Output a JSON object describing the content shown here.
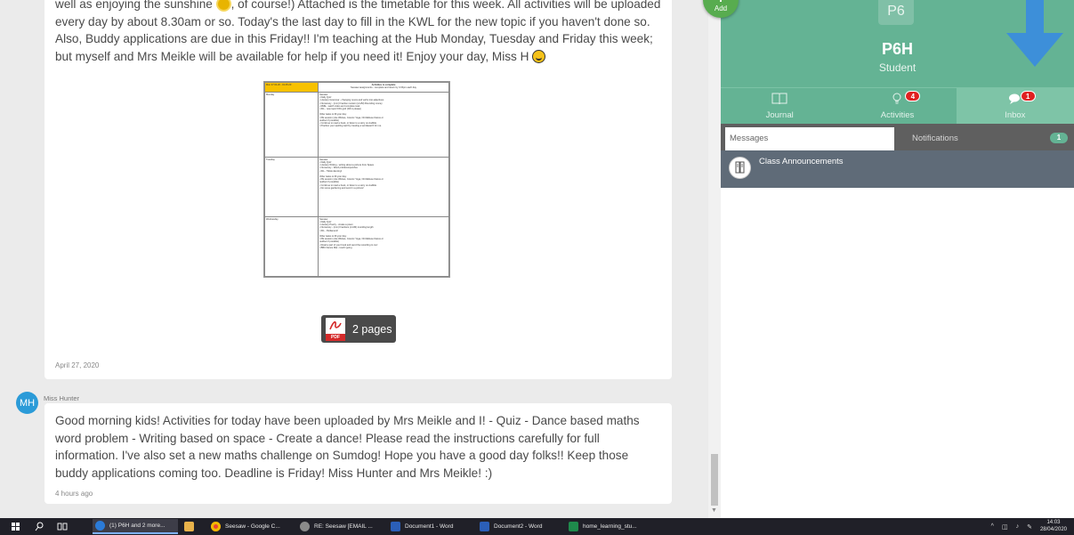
{
  "posts": [
    {
      "text_before_sun": "well as enjoying the sunshine ",
      "text_after_sun": ", of course!) Attached is the timetable for this week. All activities will be uploaded every day by about 8.30am or so. Today's the last day to fill in the KWL for the new topic if you haven't done so. Also, Buddy applications are due in this Friday!! I'm teaching at the Hub Monday, Tuesday and Friday this week; but myself and Mrs Meikle will be available for help if you need it! Enjoy your day, Miss H ",
      "attachment": {
        "timetable": {
          "head_left": "Mon 27.04.20 - 01.05.20",
          "head_title": "Activities to complete",
          "head_sub": "Seesaw assignments - complete and return by 3.15pm each day",
          "rows": [
            {
              "day": "Monday",
              "lines": [
                "Seesaw",
                "• Daily Quiz",
                "• Literacy Grammar - changing nouns and verbs into adjectives",
                "• Numeracy - (mm) Fraction revision (cm/M) Rounding money",
                "• RME - watch video and complete task",
                "• IDL - new topic KWL grid (Fill in please)",
                "",
                "Other tasks to fill your day:",
                "• PE session (Joe Wickes, Cosmic Yoga, Oti Mabuse Dance or",
                "  outdoor if possible)",
                "• Continue to read a book, or listen to a story on Audible",
                "• Practice your spelling well by creating a wordsearch for me."
              ]
            },
            {
              "day": "Tuesday",
              "lines": [
                "Seesaw",
                "• Daily Quiz",
                "• Literacy Writing - writing about a picture from Space",
                "• Numeracy - Word problems/puzzles",
                "• IDL - Tiktok dancing!",
                "",
                "Other tasks to fill your day:",
                "• PE session (Joe Wickes, Cosmic Yoga, Oti Mabuse Dance or",
                "  outdoor if possible)",
                "• Continue to read a book, or listen to a story on Audible",
                "• Do some gardening and send in a picture!"
              ]
            },
            {
              "day": "Wednesday",
              "lines": [
                "Seesaw",
                "• Daily Quiz",
                "• Literacy Poetry - create a poem",
                "• Numeracy - (mm) Fractions (cm/M) rounding length",
                "• IDL - Parliament!",
                "",
                "Other tasks to fill your day:",
                "• PE session (Joe Wickes, Cosmic Yoga, Oti Mabuse Dance or",
                "  outdoor if possible)",
                "• Read a part of your book and send the recording to me!",
                "• BBC Dance Mat - touch typing"
              ]
            }
          ]
        },
        "pdf_pages": "2 pages"
      },
      "date": "April 27, 2020"
    },
    {
      "author": "Miss Hunter",
      "avatar_initials": "MH",
      "text": "Good morning kids! Activities for today have been uploaded by Mrs Meikle and I! - Quiz - Dance based maths word problem - Writing based on space - Create a dance! Please read the instructions carefully for full information. I've also set a new maths challenge on Sumdog! Hope you have a good day folks!! Keep those buddy applications coming too. Deadline is Friday! Miss Hunter and Mrs Meikle! :)",
      "date": "4 hours ago"
    }
  ],
  "add_button": {
    "label": "Add"
  },
  "profile": {
    "class_code": "P6",
    "class_name": "P6H",
    "role": "Student"
  },
  "nav": [
    {
      "label": "Journal",
      "icon": "book-icon",
      "badge": ""
    },
    {
      "label": "Activities",
      "icon": "lightbulb-icon",
      "badge": "4"
    },
    {
      "label": "Inbox",
      "icon": "chat-icon",
      "badge": "1"
    }
  ],
  "inbox": {
    "tab_messages": "Messages",
    "tab_notifications": "Notifications",
    "notifications_count": "1",
    "announcement": "Class Announcements"
  },
  "colors": {
    "seesaw_green": "#64b394",
    "badge_red": "#e02020",
    "add_green": "#58ac4f",
    "arrow_blue": "#3d8fd9"
  },
  "taskbar": {
    "tasks": [
      {
        "label": "(1) P6H and 2 more...",
        "icon_color": "#2b7bd8",
        "active": true
      },
      {
        "label": "",
        "icon_color": "#e8b24a",
        "active": false
      },
      {
        "label": "Seesaw - Google C...",
        "icon_color": "#e94235",
        "active": false
      },
      {
        "label": "RE: Seesaw [EMAIL ...",
        "icon_color": "#8a8a8a",
        "active": false
      },
      {
        "label": "Document1 - Word",
        "icon_color": "#2b5fb8",
        "active": false
      },
      {
        "label": "Document2 - Word",
        "icon_color": "#2b5fb8",
        "active": false
      },
      {
        "label": "home_learning_stu...",
        "icon_color": "#1f8a4c",
        "active": false
      }
    ],
    "time": "14:03",
    "date": "28/04/2020"
  }
}
